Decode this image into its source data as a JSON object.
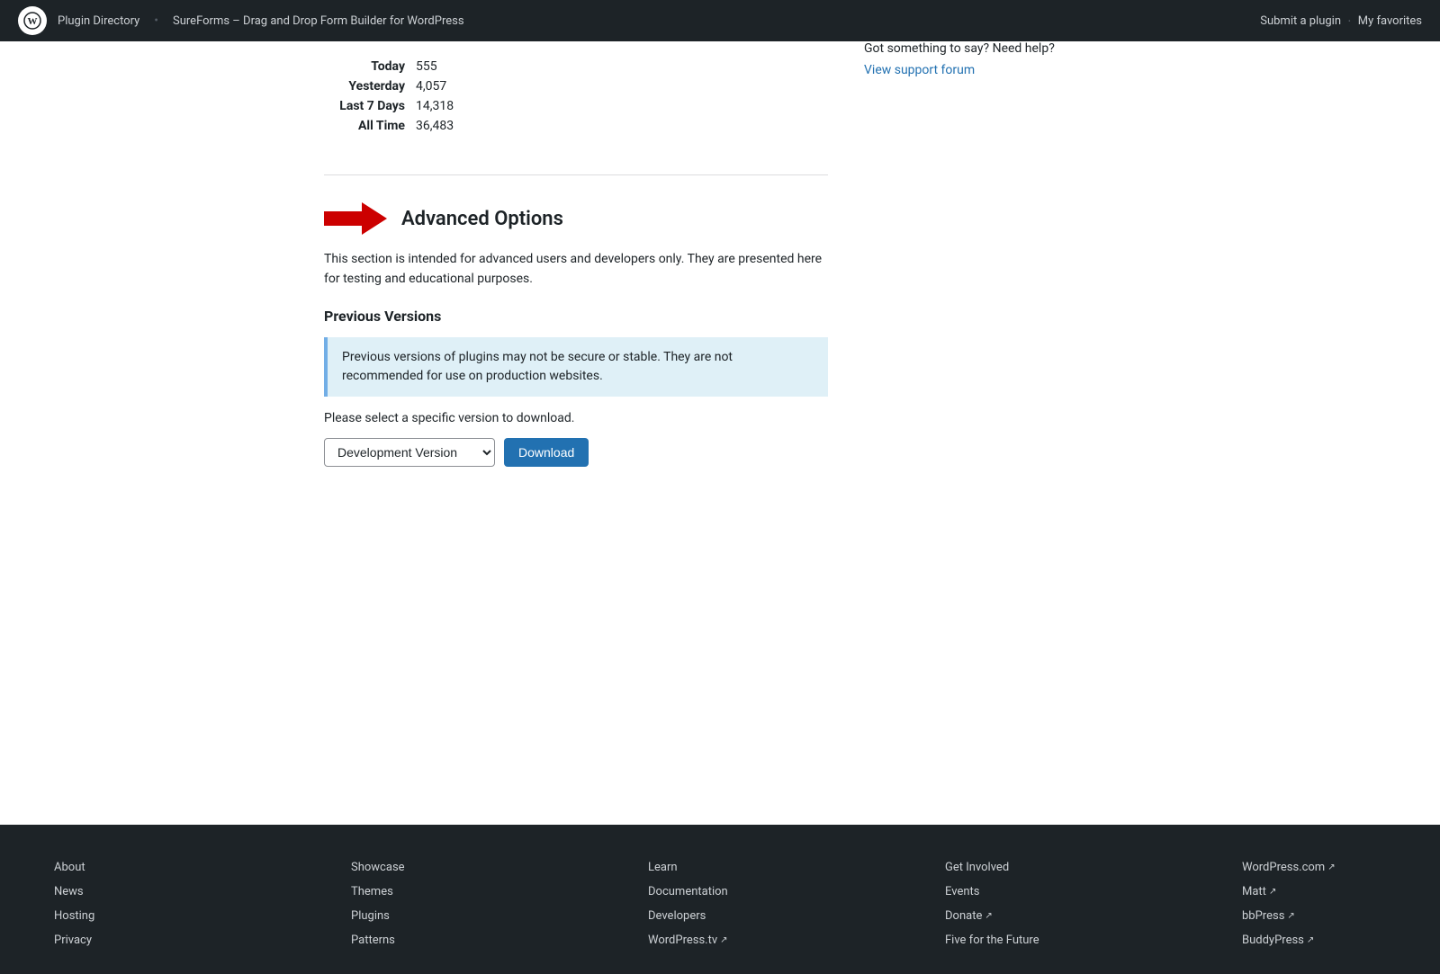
{
  "nav": {
    "plugin_directory_label": "Plugin Directory",
    "plugin_name": "SureForms – Drag and Drop Form Builder for WordPress",
    "submit_plugin_label": "Submit a plugin",
    "my_favorites_label": "My favorites"
  },
  "stats": {
    "today_label": "Today",
    "today_value": "555",
    "yesterday_label": "Yesterday",
    "yesterday_value": "4,057",
    "last7_label": "Last 7 Days",
    "last7_value": "14,318",
    "alltime_label": "All Time",
    "alltime_value": "36,483"
  },
  "advanced": {
    "section_title": "Advanced Options",
    "description": "This section is intended for advanced users and developers only. They are presented here for testing and educational purposes.",
    "previous_versions_title": "Previous Versions",
    "notice_text": "Previous versions of plugins may not be secure or stable. They are not recommended for use on production websites.",
    "please_select_text": "Please select a specific version to download.",
    "version_select_default": "Development Version",
    "download_button_label": "Download"
  },
  "sidebar": {
    "support_text": "Got something to say? Need help?",
    "support_forum_label": "View support forum"
  },
  "footer": {
    "col1": [
      {
        "label": "About",
        "ext": false
      },
      {
        "label": "News",
        "ext": false
      },
      {
        "label": "Hosting",
        "ext": false
      },
      {
        "label": "Privacy",
        "ext": false
      }
    ],
    "col2": [
      {
        "label": "Showcase",
        "ext": false
      },
      {
        "label": "Themes",
        "ext": false
      },
      {
        "label": "Plugins",
        "ext": false
      },
      {
        "label": "Patterns",
        "ext": false
      }
    ],
    "col3": [
      {
        "label": "Learn",
        "ext": false
      },
      {
        "label": "Documentation",
        "ext": false
      },
      {
        "label": "Developers",
        "ext": false
      },
      {
        "label": "WordPress.tv",
        "ext": true
      }
    ],
    "col4": [
      {
        "label": "Get Involved",
        "ext": false
      },
      {
        "label": "Events",
        "ext": false
      },
      {
        "label": "Donate",
        "ext": true
      },
      {
        "label": "Five for the Future",
        "ext": false
      }
    ],
    "col5": [
      {
        "label": "WordPress.com",
        "ext": true
      },
      {
        "label": "Matt",
        "ext": true
      },
      {
        "label": "bbPress",
        "ext": true
      },
      {
        "label": "BuddyPress",
        "ext": true
      }
    ]
  }
}
